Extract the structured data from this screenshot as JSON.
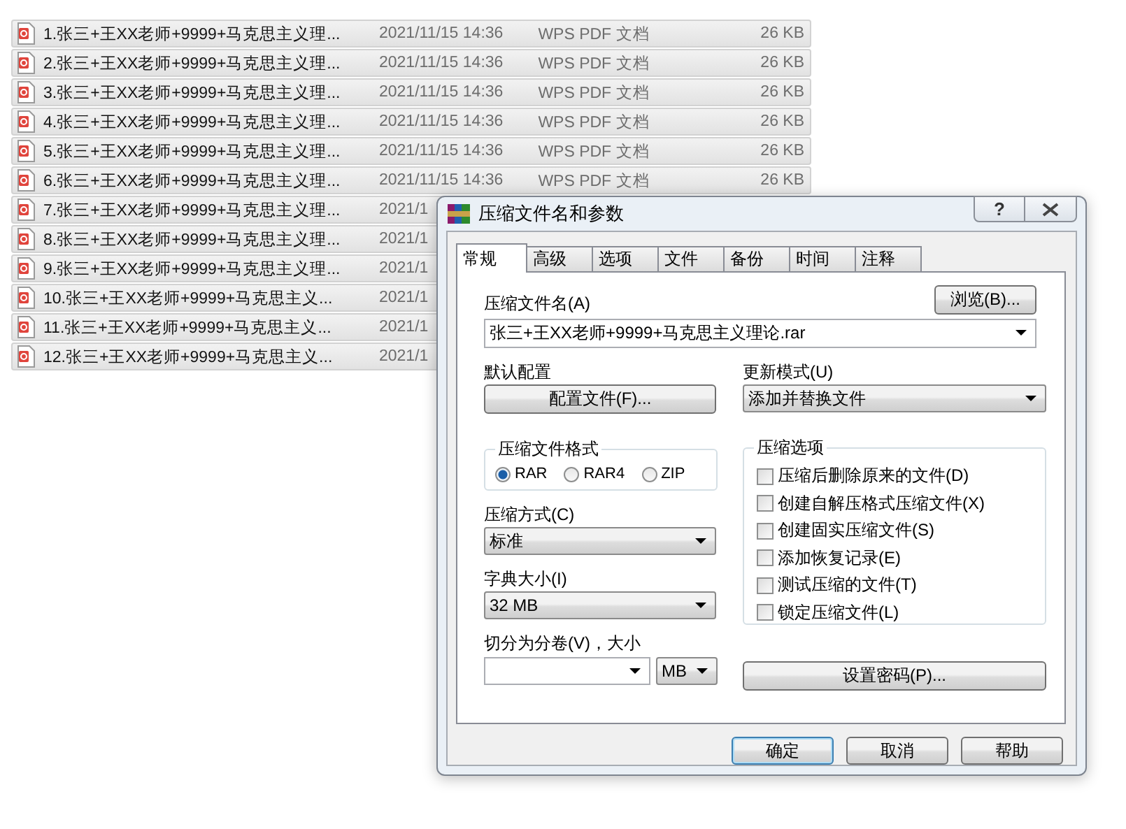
{
  "file_list": {
    "rows": [
      {
        "name": "1.张三+王XX老师+9999+马克思主义理...",
        "date": "2021/11/15 14:36",
        "type": "WPS PDF 文档",
        "size": "26 KB",
        "selected": true
      },
      {
        "name": "2.张三+王XX老师+9999+马克思主义理...",
        "date": "2021/11/15 14:36",
        "type": "WPS PDF 文档",
        "size": "26 KB",
        "selected": true
      },
      {
        "name": "3.张三+王XX老师+9999+马克思主义理...",
        "date": "2021/11/15 14:36",
        "type": "WPS PDF 文档",
        "size": "26 KB",
        "selected": true
      },
      {
        "name": "4.张三+王XX老师+9999+马克思主义理...",
        "date": "2021/11/15 14:36",
        "type": "WPS PDF 文档",
        "size": "26 KB",
        "selected": true
      },
      {
        "name": "5.张三+王XX老师+9999+马克思主义理...",
        "date": "2021/11/15 14:36",
        "type": "WPS PDF 文档",
        "size": "26 KB",
        "selected": true
      },
      {
        "name": "6.张三+王XX老师+9999+马克思主义理...",
        "date": "2021/11/15 14:36",
        "type": "WPS PDF 文档",
        "size": "26 KB",
        "selected": true
      },
      {
        "name": "7.张三+王XX老师+9999+马克思主义理...",
        "date": "2021/1",
        "selected": true
      },
      {
        "name": "8.张三+王XX老师+9999+马克思主义理...",
        "date": "2021/1",
        "selected": true
      },
      {
        "name": "9.张三+王XX老师+9999+马克思主义理...",
        "date": "2021/1",
        "selected": true
      },
      {
        "name": "10.张三+王XX老师+9999+马克思主义...",
        "date": "2021/1",
        "selected": true
      },
      {
        "name": "11.张三+王XX老师+9999+马克思主义...",
        "date": "2021/1",
        "selected": true
      },
      {
        "name": "12.张三+王XX老师+9999+马克思主义...",
        "date": "2021/1",
        "selected": true
      }
    ]
  },
  "dialog": {
    "title": "压缩文件名和参数",
    "help_button": "?",
    "tabs": [
      {
        "label": "常规",
        "selected": true
      },
      {
        "label": "高级",
        "selected": false
      },
      {
        "label": "选项",
        "selected": false
      },
      {
        "label": "文件",
        "selected": false
      },
      {
        "label": "备份",
        "selected": false
      },
      {
        "label": "时间",
        "selected": false
      },
      {
        "label": "注释",
        "selected": false
      }
    ],
    "archive_name": {
      "label": "压缩文件名(A)",
      "value": "张三+王XX老师+9999+马克思主义理论.rar",
      "browse_button": "浏览(B)..."
    },
    "default_profile": {
      "label": "默认配置",
      "button": "配置文件(F)..."
    },
    "update_mode": {
      "label": "更新模式(U)",
      "value": "添加并替换文件"
    },
    "archive_format": {
      "label": "压缩文件格式",
      "options": [
        {
          "label": "RAR",
          "selected": true
        },
        {
          "label": "RAR4",
          "selected": false
        },
        {
          "label": "ZIP",
          "selected": false
        }
      ]
    },
    "compression_method": {
      "label": "压缩方式(C)",
      "value": "标准"
    },
    "dictionary_size": {
      "label": "字典大小(I)",
      "value": "32 MB"
    },
    "split": {
      "label": "切分为分卷(V)，大小",
      "unit": "MB"
    },
    "archive_options": {
      "label": "压缩选项",
      "items": [
        {
          "label": "压缩后删除原来的文件(D)",
          "checked": false
        },
        {
          "label": "创建自解压格式压缩文件(X)",
          "checked": false
        },
        {
          "label": "创建固实压缩文件(S)",
          "checked": false
        },
        {
          "label": "添加恢复记录(E)",
          "checked": false
        },
        {
          "label": "测试压缩的文件(T)",
          "checked": false
        },
        {
          "label": "锁定压缩文件(L)",
          "checked": false
        }
      ]
    },
    "password_button": "设置密码(P)...",
    "buttons": [
      {
        "label": "确定",
        "default": true
      },
      {
        "label": "取消",
        "default": false
      },
      {
        "label": "帮助",
        "default": false
      }
    ]
  }
}
